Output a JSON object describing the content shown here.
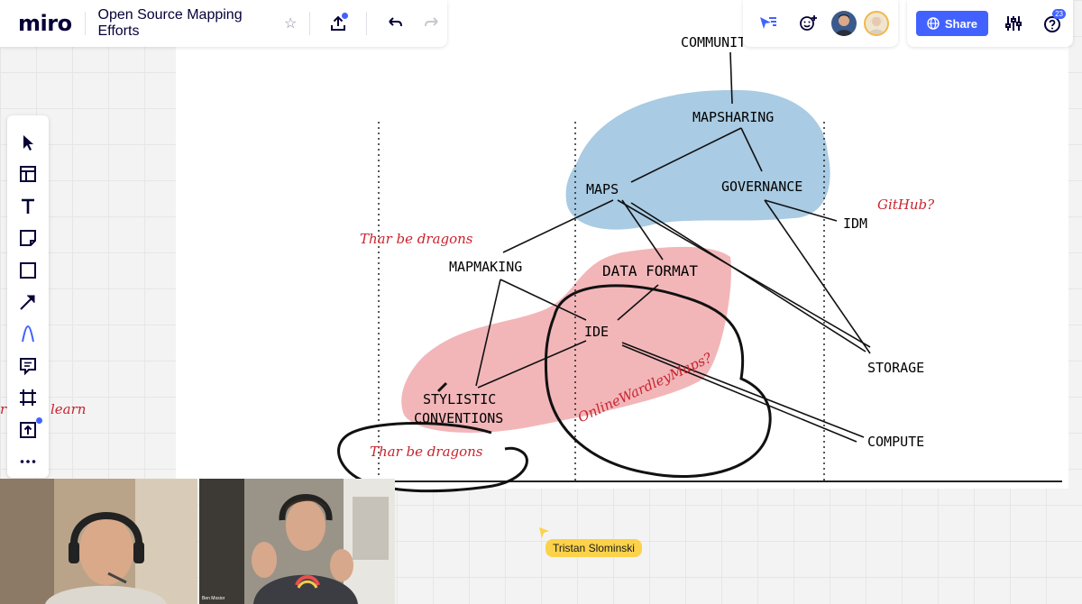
{
  "app": {
    "logo": "miro",
    "board_title": "Open Source Mapping Efforts"
  },
  "topbar": {
    "share_label": "Share",
    "notifications_count": "23"
  },
  "toolbar": {
    "items": [
      "select-tool",
      "templates-tool",
      "text-tool",
      "sticky-note-tool",
      "shape-tool",
      "arrow-tool",
      "pen-tool",
      "comment-tool",
      "frame-tool",
      "upload-tool",
      "more-tools"
    ]
  },
  "map": {
    "nodes": {
      "community": "COMMUNITY",
      "mapsharing": "MAPSHARING",
      "maps": "MAPS",
      "governance": "GOVERNANCE",
      "idm": "IDM",
      "mapmaking": "MAPMAKING",
      "data_format": "DATA FORMAT",
      "ide": "IDE",
      "storage": "STORAGE",
      "stylistic_line1": "STYLISTIC",
      "stylistic_line2": "CONVENTIONS",
      "compute": "COMPUTE"
    },
    "annotations": {
      "github": "GitHub?",
      "dragons_top": "Thar be dragons",
      "dragons_bottom": "Thar be dragons",
      "online_wardley": "OnlineWardleyMaps?",
      "learn_fragment_left": "r",
      "learn_fragment_word": "learn"
    },
    "colors": {
      "blue_region": "#a9cbe3",
      "red_region": "#f2b6b9",
      "annotation_red": "#c8242e"
    }
  },
  "collaborators": {
    "cursor_name": "Tristan Slominski"
  },
  "video": {
    "tile2_caption": "Ben Mosior"
  }
}
